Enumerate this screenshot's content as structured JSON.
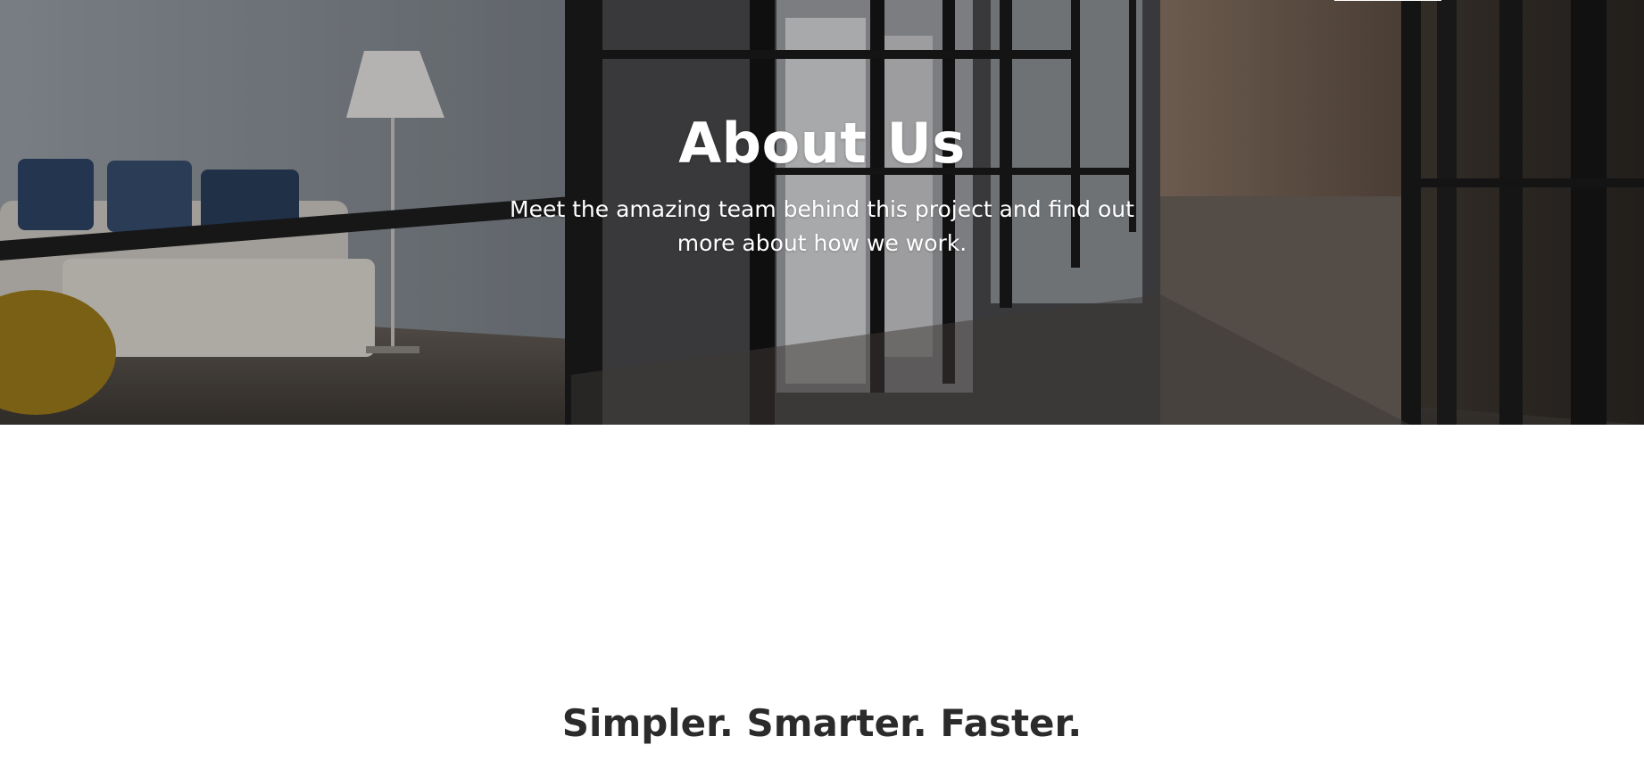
{
  "hero": {
    "title": "About Us",
    "subtitle": "Meet the amazing team behind this project and find out more about how we work."
  },
  "intro": {
    "heading": "Simpler. Smarter. Faster."
  },
  "colors": {
    "hero_text": "#ffffff",
    "heading_text": "#2b2b2b",
    "page_background": "#ffffff"
  }
}
